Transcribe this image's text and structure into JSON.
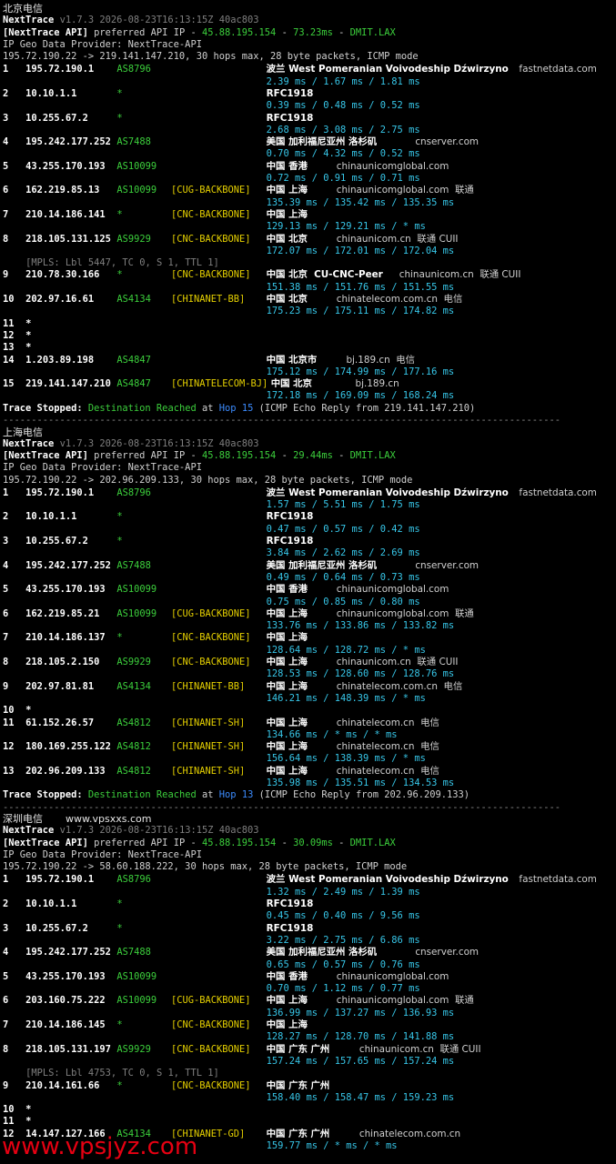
{
  "sections": [
    {
      "title": "北京电信",
      "site": "",
      "version_line": "v1.7.3 2026-08-23T16:13:15Z 40ac803",
      "api_ip": "45.88.195.154",
      "api_rtt": "73.23ms",
      "api_loc": "DMIT.LAX",
      "geo_provider": "IP Geo Data Provider: NextTrace-API",
      "trace_cmd": "195.72.190.22 -> 219.141.147.210, 30 hops max, 28 byte packets, ICMP mode",
      "rows": [
        {
          "t": "hop",
          "n": "1",
          "ip": "195.72.190.1",
          "asn": "AS8796",
          "tag": "",
          "geo": "波兰 West Pomeranian Voivodeship Dźwirzyno",
          "host": "fastnetdata.com",
          "rtt": "2.39 ms / 1.67 ms / 1.81 ms"
        },
        {
          "t": "hop",
          "n": "2",
          "ip": "10.10.1.1",
          "asn": "*",
          "tag": "",
          "geo": "RFC1918",
          "host": "",
          "rtt": "0.39 ms / 0.48 ms / 0.52 ms"
        },
        {
          "t": "hop",
          "n": "3",
          "ip": "10.255.67.2",
          "asn": "*",
          "tag": "",
          "geo": "RFC1918",
          "host": "",
          "rtt": "2.68 ms / 3.08 ms / 2.75 ms"
        },
        {
          "t": "hop",
          "n": "4",
          "ip": "195.242.177.252",
          "asn": "AS7488",
          "tag": "",
          "geo": "美国 加利福尼亚州 洛杉矶",
          "host": "cnserver.com",
          "rtt": "0.70 ms / 4.32 ms / 0.52 ms"
        },
        {
          "t": "hop",
          "n": "5",
          "ip": "43.255.170.193",
          "asn": "AS10099",
          "tag": "",
          "geo": "中国 香港",
          "host": "chinaunicomglobal.com",
          "rtt": "0.72 ms / 0.91 ms / 0.71 ms"
        },
        {
          "t": "hop",
          "n": "6",
          "ip": "162.219.85.13",
          "asn": "AS10099",
          "tag": "[CUG-BACKBONE]",
          "geo": "中国 上海",
          "host": "chinaunicomglobal.com  联通",
          "rtt": "135.39 ms / 135.42 ms / 135.35 ms"
        },
        {
          "t": "hop",
          "n": "7",
          "ip": "210.14.186.141",
          "asn": "*",
          "tag": "[CNC-BACKBONE]",
          "geo": "中国 上海",
          "host": "",
          "rtt": "129.13 ms / 129.21 ms / * ms"
        },
        {
          "t": "hop",
          "n": "8",
          "ip": "218.105.131.125",
          "asn": "AS9929",
          "tag": "[CNC-BACKBONE]",
          "geo": "中国 北京",
          "host": "chinaunicom.cn  联通 CUII",
          "rtt": "172.07 ms / 172.01 ms / 172.04 ms"
        },
        {
          "t": "mpls",
          "text": "[MPLS: Lbl 5447, TC 0, S 1, TTL 1]"
        },
        {
          "t": "hop",
          "n": "9",
          "ip": "210.78.30.166",
          "asn": "*",
          "tag": "[CNC-BACKBONE]",
          "geo": "中国 北京  CU-CNC-Peer",
          "host": "chinaunicom.cn  联通 CUII",
          "rtt": "151.38 ms / 151.76 ms / 151.55 ms"
        },
        {
          "t": "hop",
          "n": "10",
          "ip": "202.97.16.61",
          "asn": "AS4134",
          "tag": "[CHINANET-BB]",
          "geo": "中国 北京",
          "host": "chinatelecom.com.cn  电信",
          "rtt": "175.23 ms / 175.11 ms / 174.82 ms"
        },
        {
          "t": "star",
          "n": "11"
        },
        {
          "t": "star",
          "n": "12"
        },
        {
          "t": "star",
          "n": "13"
        },
        {
          "t": "hop",
          "n": "14",
          "ip": "1.203.89.198",
          "asn": "AS4847",
          "tag": "",
          "geo": "中国 北京市",
          "host": "bj.189.cn  电信",
          "rtt": "175.12 ms / 174.99 ms / 177.16 ms"
        },
        {
          "t": "hop",
          "n": "15",
          "ip": "219.141.147.210",
          "asn": "AS4847",
          "tag": "[CHINATELECOM-BJ]",
          "geo": "中国 北京",
          "host": "bj.189.cn",
          "rtt": "172.18 ms / 169.09 ms / 168.24 ms"
        }
      ],
      "stop_hop": "15",
      "stop_tail": "(ICMP Echo Reply from 219.141.147.210)"
    },
    {
      "title": "上海电信",
      "site": "",
      "version_line": "v1.7.3 2026-08-23T16:13:15Z 40ac803",
      "api_ip": "45.88.195.154",
      "api_rtt": "29.44ms",
      "api_loc": "DMIT.LAX",
      "geo_provider": "IP Geo Data Provider: NextTrace-API",
      "trace_cmd": "195.72.190.22 -> 202.96.209.133, 30 hops max, 28 byte packets, ICMP mode",
      "rows": [
        {
          "t": "hop",
          "n": "1",
          "ip": "195.72.190.1",
          "asn": "AS8796",
          "tag": "",
          "geo": "波兰 West Pomeranian Voivodeship Dźwirzyno",
          "host": "fastnetdata.com",
          "rtt": "1.57 ms / 5.51 ms / 1.75 ms"
        },
        {
          "t": "hop",
          "n": "2",
          "ip": "10.10.1.1",
          "asn": "*",
          "tag": "",
          "geo": "RFC1918",
          "host": "",
          "rtt": "0.47 ms / 0.57 ms / 0.42 ms"
        },
        {
          "t": "hop",
          "n": "3",
          "ip": "10.255.67.2",
          "asn": "*",
          "tag": "",
          "geo": "RFC1918",
          "host": "",
          "rtt": "3.84 ms / 2.62 ms / 2.69 ms"
        },
        {
          "t": "hop",
          "n": "4",
          "ip": "195.242.177.252",
          "asn": "AS7488",
          "tag": "",
          "geo": "美国 加利福尼亚州 洛杉矶",
          "host": "cnserver.com",
          "rtt": "0.49 ms / 0.64 ms / 0.73 ms"
        },
        {
          "t": "hop",
          "n": "5",
          "ip": "43.255.170.193",
          "asn": "AS10099",
          "tag": "",
          "geo": "中国 香港",
          "host": "chinaunicomglobal.com",
          "rtt": "0.75 ms / 0.85 ms / 0.80 ms"
        },
        {
          "t": "hop",
          "n": "6",
          "ip": "162.219.85.21",
          "asn": "AS10099",
          "tag": "[CUG-BACKBONE]",
          "geo": "中国 上海",
          "host": "chinaunicomglobal.com  联通",
          "rtt": "133.76 ms / 133.86 ms / 133.82 ms"
        },
        {
          "t": "hop",
          "n": "7",
          "ip": "210.14.186.137",
          "asn": "*",
          "tag": "[CNC-BACKBONE]",
          "geo": "中国 上海",
          "host": "",
          "rtt": "128.64 ms / 128.72 ms / * ms"
        },
        {
          "t": "hop",
          "n": "8",
          "ip": "218.105.2.150",
          "asn": "AS9929",
          "tag": "[CNC-BACKBONE]",
          "geo": "中国 上海",
          "host": "chinaunicom.cn  联通 CUII",
          "rtt": "128.53 ms / 128.60 ms / 128.76 ms"
        },
        {
          "t": "hop",
          "n": "9",
          "ip": "202.97.81.81",
          "asn": "AS4134",
          "tag": "[CHINANET-BB]",
          "geo": "中国 上海",
          "host": "chinatelecom.com.cn  电信",
          "rtt": "146.21 ms / 148.39 ms / * ms"
        },
        {
          "t": "star",
          "n": "10"
        },
        {
          "t": "hop",
          "n": "11",
          "ip": "61.152.26.57",
          "asn": "AS4812",
          "tag": "[CHINANET-SH]",
          "geo": "中国 上海",
          "host": "chinatelecom.cn  电信",
          "rtt": "134.66 ms / * ms / * ms"
        },
        {
          "t": "hop",
          "n": "12",
          "ip": "180.169.255.122",
          "asn": "AS4812",
          "tag": "[CHINANET-SH]",
          "geo": "中国 上海",
          "host": "chinatelecom.cn  电信",
          "rtt": "156.64 ms / 138.39 ms / * ms"
        },
        {
          "t": "hop",
          "n": "13",
          "ip": "202.96.209.133",
          "asn": "AS4812",
          "tag": "[CHINANET-SH]",
          "geo": "中国 上海",
          "host": "chinatelecom.cn  电信",
          "rtt": "135.98 ms / 135.51 ms / 134.53 ms"
        }
      ],
      "stop_hop": "13",
      "stop_tail": "(ICMP Echo Reply from 202.96.209.133)"
    },
    {
      "title": "深圳电信",
      "site": "www.vpsxxs.com",
      "version_line": "v1.7.3 2026-08-23T16:13:15Z 40ac803",
      "api_ip": "45.88.195.154",
      "api_rtt": "30.09ms",
      "api_loc": "DMIT.LAX",
      "geo_provider": "IP Geo Data Provider: NextTrace-API",
      "trace_cmd": "195.72.190.22 -> 58.60.188.222, 30 hops max, 28 byte packets, ICMP mode",
      "rows": [
        {
          "t": "hop",
          "n": "1",
          "ip": "195.72.190.1",
          "asn": "AS8796",
          "tag": "",
          "geo": "波兰 West Pomeranian Voivodeship Dźwirzyno",
          "host": "fastnetdata.com",
          "rtt": "1.32 ms / 2.49 ms / 1.39 ms"
        },
        {
          "t": "hop",
          "n": "2",
          "ip": "10.10.1.1",
          "asn": "*",
          "tag": "",
          "geo": "RFC1918",
          "host": "",
          "rtt": "0.45 ms / 0.40 ms / 9.56 ms"
        },
        {
          "t": "hop",
          "n": "3",
          "ip": "10.255.67.2",
          "asn": "*",
          "tag": "",
          "geo": "RFC1918",
          "host": "",
          "rtt": "3.22 ms / 2.75 ms / 6.86 ms"
        },
        {
          "t": "hop",
          "n": "4",
          "ip": "195.242.177.252",
          "asn": "AS7488",
          "tag": "",
          "geo": "美国 加利福尼亚州 洛杉矶",
          "host": "cnserver.com",
          "rtt": "0.65 ms / 0.57 ms / 0.76 ms"
        },
        {
          "t": "hop",
          "n": "5",
          "ip": "43.255.170.193",
          "asn": "AS10099",
          "tag": "",
          "geo": "中国 香港",
          "host": "chinaunicomglobal.com",
          "rtt": "0.70 ms / 1.12 ms / 0.77 ms"
        },
        {
          "t": "hop",
          "n": "6",
          "ip": "203.160.75.222",
          "asn": "AS10099",
          "tag": "[CUG-BACKBONE]",
          "geo": "中国 上海",
          "host": "chinaunicomglobal.com  联通",
          "rtt": "136.99 ms / 137.27 ms / 136.93 ms"
        },
        {
          "t": "hop",
          "n": "7",
          "ip": "210.14.186.145",
          "asn": "*",
          "tag": "[CNC-BACKBONE]",
          "geo": "中国 上海",
          "host": "",
          "rtt": "128.27 ms / 128.70 ms / 141.88 ms"
        },
        {
          "t": "hop",
          "n": "8",
          "ip": "218.105.131.197",
          "asn": "AS9929",
          "tag": "[CNC-BACKBONE]",
          "geo": "中国 广东 广州",
          "host": "chinaunicom.cn  联通 CUII",
          "rtt": "157.24 ms / 157.65 ms / 157.24 ms"
        },
        {
          "t": "mpls",
          "text": "[MPLS: Lbl 4753, TC 0, S 1, TTL 1]"
        },
        {
          "t": "hop",
          "n": "9",
          "ip": "210.14.161.66",
          "asn": "*",
          "tag": "[CNC-BACKBONE]",
          "geo": "中国 广东 广州",
          "host": "",
          "rtt": "158.40 ms / 158.47 ms / 159.23 ms"
        },
        {
          "t": "star",
          "n": "10"
        },
        {
          "t": "star",
          "n": "11"
        },
        {
          "t": "hop",
          "n": "12",
          "ip": "14.147.127.166",
          "asn": "AS4134",
          "tag": "[CHINANET-GD]",
          "geo": "中国 广东 广州",
          "host": "chinatelecom.com.cn",
          "rtt": "159.77 ms / * ms / * ms"
        }
      ],
      "stop_hop": "",
      "stop_tail": ""
    }
  ],
  "labels": {
    "nexttrace": "NextTrace",
    "api_prefix": "[NextTrace API]",
    "api_mid": "preferred API IP -",
    "trace_stopped": "Trace Stopped:",
    "destination_reached": "Destination Reached",
    "at_hop": "at",
    "hop_word": "Hop",
    "separator": "--------------------------------------------------------------------------------------------------"
  },
  "watermark": "www.vpsjyz.com",
  "colors": {
    "background": "#000000",
    "asn_green": "#3ccf3c",
    "tag_yellow": "#e5d000",
    "rtt_cyan": "#37c6e8",
    "hop_blue": "#3c8cff",
    "watermark_red": "#e60012"
  }
}
